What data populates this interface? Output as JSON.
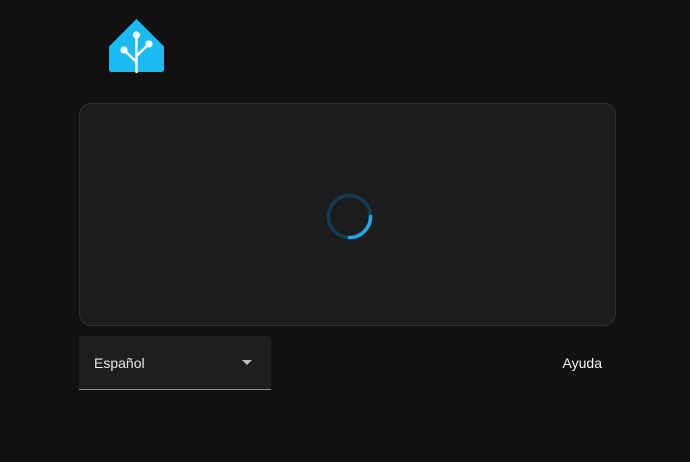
{
  "branding": {
    "logo_icon": "home-assistant-logo-icon",
    "logo_color": "#18BCF2"
  },
  "card": {
    "loading_icon": "loading-spinner-icon",
    "spinner_color": "#1FA9E8"
  },
  "footer": {
    "language_select": {
      "selected": "Español",
      "icon": "chevron-down-icon"
    },
    "help_label": "Ayuda"
  }
}
